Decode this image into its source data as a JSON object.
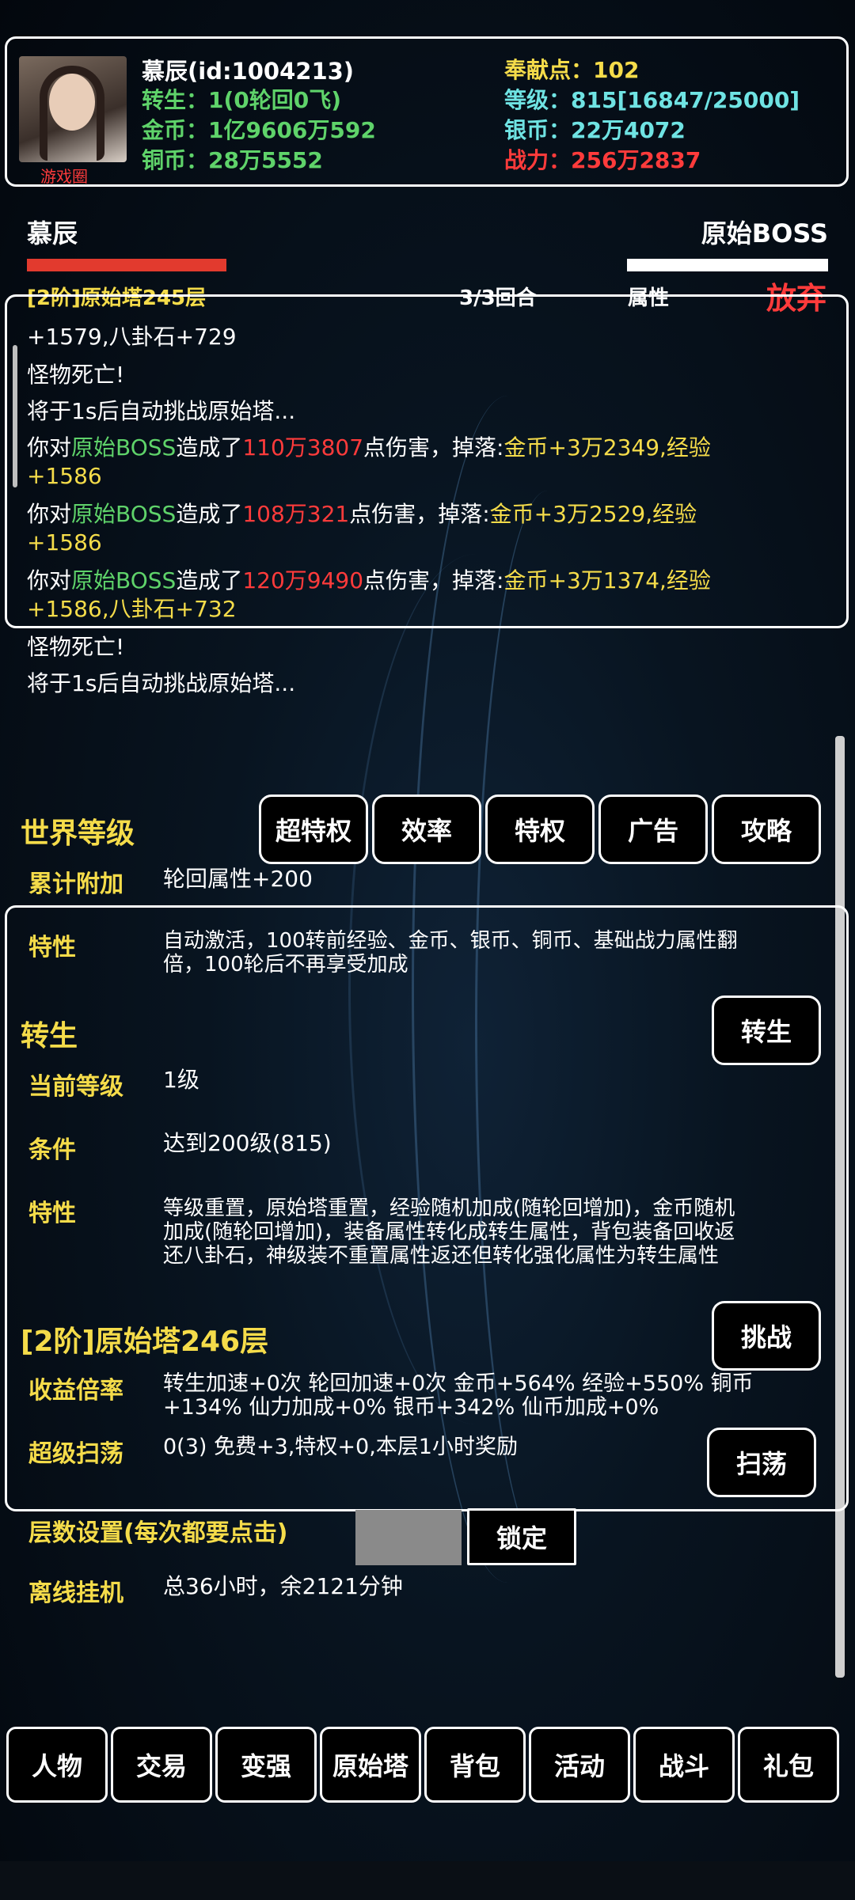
{
  "player": {
    "avatar_caption": "游戏圈",
    "name_id": "慕辰(id:1004213)",
    "rebirth": "转生：1(0轮回0飞)",
    "gold": "金币：1亿9606万592",
    "copper": "铜币：28万5552",
    "contribution": "奉献点：102",
    "level": "等级：815[16847/25000]",
    "silver": "银币：22万4072",
    "power": "战力：256万2837"
  },
  "battle": {
    "player_name": "慕辰",
    "enemy_name": "原始BOSS",
    "player_hp": 0.3,
    "enemy_hp": 0.3,
    "stage": "[2阶]原始塔245层",
    "round": "3/3回合",
    "attr": "属性",
    "abandon": "放弃"
  },
  "log": {
    "l1": "+1579,八卦石+729",
    "l2": "怪物死亡!",
    "l3": "将于1s后自动挑战原始塔...",
    "e1": {
      "a": "你对",
      "b": "原始BOSS",
      "c": "造成了",
      "d": "110万3807",
      "e": "点伤害，掉落:",
      "f": "金币+3万2349,经验",
      "g": "+1586"
    },
    "e2": {
      "a": "你对",
      "b": "原始BOSS",
      "c": "造成了",
      "d": "108万321",
      "e": "点伤害，掉落:",
      "f": "金币+3万2529,经验",
      "g": "+1586"
    },
    "e3": {
      "a": "你对",
      "b": "原始BOSS",
      "c": "造成了",
      "d": "120万9490",
      "e": "点伤害，掉落:",
      "f": "金币+3万1374,经验",
      "g": "+1586,八卦石+732"
    },
    "l4": "怪物死亡!",
    "l5": "将于1s后自动挑战原始塔..."
  },
  "world": {
    "title": "世界等级",
    "buttons": [
      "超特权",
      "效率",
      "特权",
      "广告",
      "攻略"
    ],
    "bonus_label": "累计附加",
    "bonus_value": "轮回属性+200"
  },
  "panel": {
    "trait_label": "特性",
    "trait_value": "自动激活，100转前经验、金币、银币、铜币、基础战力属性翻倍，100轮后不再享受加成",
    "rebirth_title": "转生",
    "rebirth_btn": "转生",
    "cur_level_label": "当前等级",
    "cur_level_value": "1级",
    "cond_label": "条件",
    "cond_value": "达到200级(815)",
    "trait2_label": "特性",
    "trait2_value": "等级重置，原始塔重置，经验随机加成(随轮回增加)，金币随机加成(随轮回增加)，装备属性转化成转生属性，背包装备回收返还八卦石，神级装不重置属性返还但转化强化属性为转生属性",
    "tower_title": "[2阶]原始塔246层",
    "challenge_btn": "挑战",
    "yield_label": "收益倍率",
    "yield_value": "转生加速+0次 轮回加速+0次 金币+564% 经验+550% 铜币+134% 仙力加成+0% 银币+342% 仙币加成+0%",
    "sweep_label": "超级扫荡",
    "sweep_value": "0(3) 免费+3,特权+0,本层1小时奖励",
    "sweep_btn": "扫荡"
  },
  "floor": {
    "label": "层数设置(每次都要点击)",
    "lock_btn": "锁定",
    "offline_label": "离线挂机",
    "offline_value": "总36小时，余2121分钟"
  },
  "nav": [
    "人物",
    "交易",
    "变强",
    "原始塔",
    "背包",
    "活动",
    "战斗",
    "礼包"
  ]
}
